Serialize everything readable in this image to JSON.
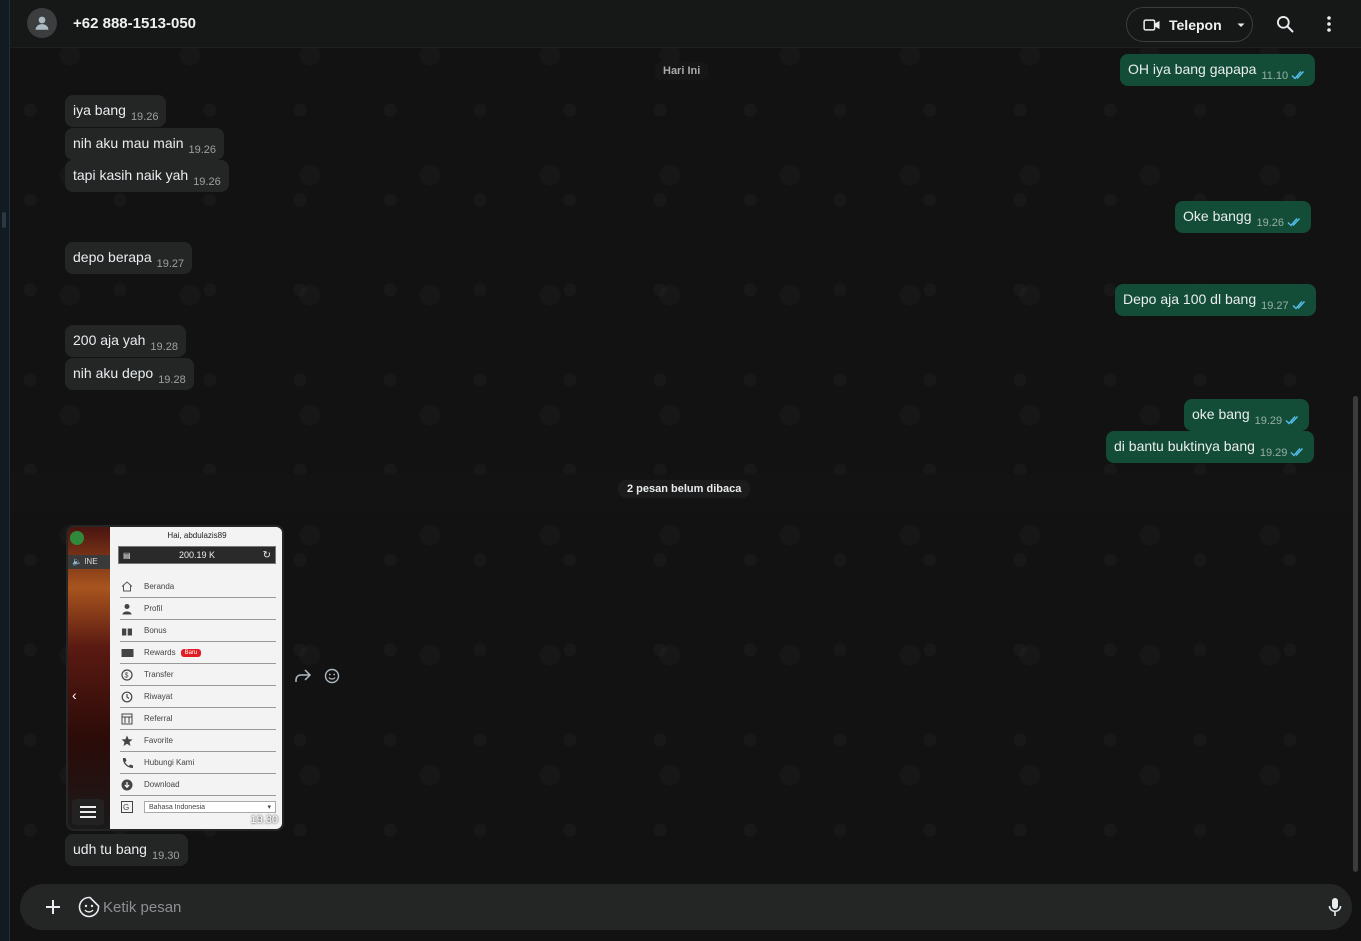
{
  "header": {
    "contact_name": "+62 888-1513-050",
    "call_label": "Telepon"
  },
  "chat": {
    "date_label": "Hari Ini",
    "unread_label": "2 pesan belum dibaca",
    "messages": [
      {
        "dir": "out",
        "text": "OH iya bang gapapa",
        "time": "11.10",
        "status": "read"
      },
      {
        "dir": "in",
        "text": "iya bang",
        "time": "19.26"
      },
      {
        "dir": "in",
        "text": "nih aku mau main",
        "time": "19.26"
      },
      {
        "dir": "in",
        "text": "tapi kasih naik yah",
        "time": "19.26"
      },
      {
        "dir": "out",
        "text": "Oke bangg",
        "time": "19.26",
        "status": "read"
      },
      {
        "dir": "in",
        "text": "depo berapa",
        "time": "19.27"
      },
      {
        "dir": "out",
        "text": "Depo aja 100 dl bang",
        "time": "19.27",
        "status": "read"
      },
      {
        "dir": "in",
        "text": "200 aja yah",
        "time": "19.28"
      },
      {
        "dir": "in",
        "text": "nih aku depo",
        "time": "19.28"
      },
      {
        "dir": "out",
        "text": "oke bang",
        "time": "19.29",
        "status": "read"
      },
      {
        "dir": "out",
        "text": "di bantu buktinya bang",
        "time": "19.29",
        "status": "read"
      },
      {
        "dir": "in",
        "text": "udh tu bang",
        "time": "19.30"
      }
    ],
    "image_message": {
      "time": "19.30",
      "screenshot": {
        "greeting": "Hai,  abdulazis89",
        "balance": "200.19 K",
        "side_text": "INE",
        "menu": [
          {
            "label": "Beranda",
            "icon": "home-icon"
          },
          {
            "label": "Profil",
            "icon": "user-icon"
          },
          {
            "label": "Bonus",
            "icon": "gift-icon"
          },
          {
            "label": "Rewards",
            "icon": "ticket-icon",
            "badge": "Baru"
          },
          {
            "label": "Transfer",
            "icon": "transfer-icon"
          },
          {
            "label": "Riwayat",
            "icon": "history-icon"
          },
          {
            "label": "Referral",
            "icon": "referral-icon"
          },
          {
            "label": "Favorite",
            "icon": "star-icon"
          },
          {
            "label": "Hubungi Kami",
            "icon": "phone-icon"
          },
          {
            "label": "Download",
            "icon": "download-icon"
          }
        ],
        "language": "Bahasa Indonesia"
      }
    }
  },
  "composer": {
    "placeholder": "Ketik pesan"
  },
  "colors": {
    "incoming_bubble": "#242626",
    "outgoing_bubble": "#144d37",
    "read_tick": "#53bdeb",
    "background": "#121212"
  }
}
